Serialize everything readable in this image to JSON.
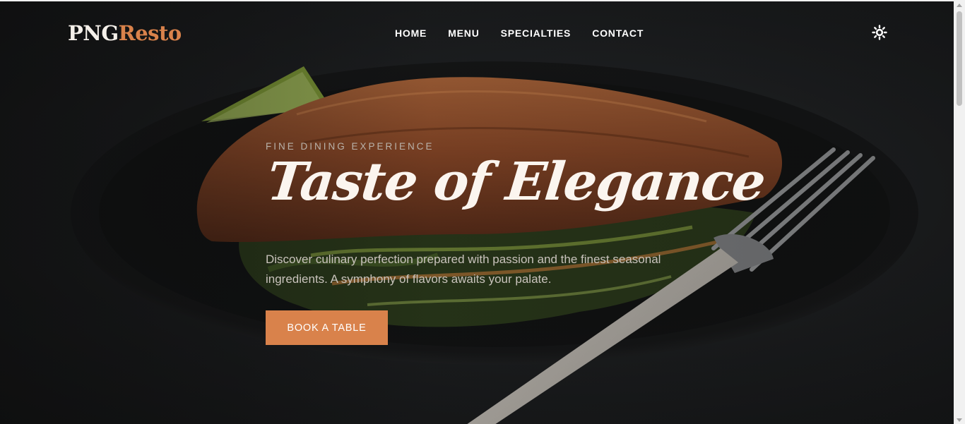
{
  "brand": {
    "name_main": "PNG",
    "name_accent": "Resto",
    "accent_color": "#d9824b"
  },
  "nav": {
    "items": [
      {
        "label": "HOME"
      },
      {
        "label": "MENU"
      },
      {
        "label": "SPECIALTIES"
      },
      {
        "label": "CONTACT"
      }
    ],
    "theme_toggle_icon": "sun-icon"
  },
  "hero": {
    "eyebrow": "FINE DINING EXPERIENCE",
    "headline": "Taste of Elegance",
    "description": "Discover culinary perfection prepared with passion and the finest seasonal ingredients. A symphony of flavors awaits your palate.",
    "cta_label": "BOOK A TABLE",
    "background_image": "salmon-dish-photo"
  }
}
